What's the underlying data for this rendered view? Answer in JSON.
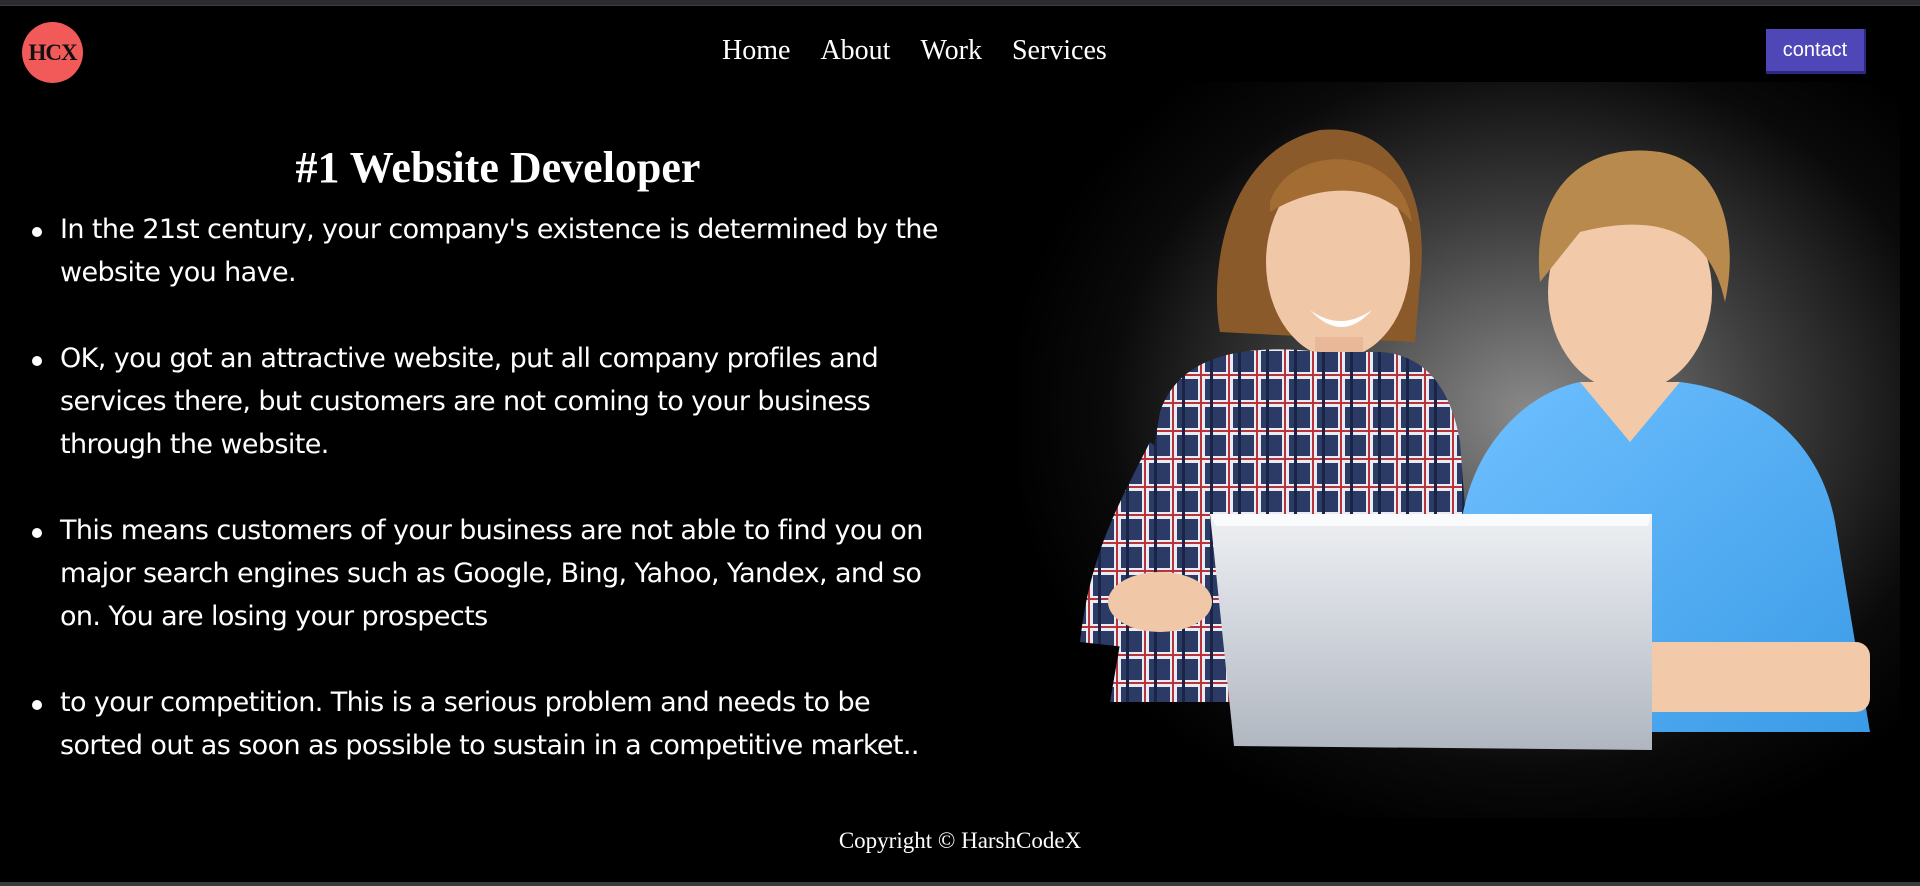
{
  "header": {
    "logo_text": "HCX",
    "nav": [
      "Home",
      "About",
      "Work",
      "Services"
    ],
    "contact_label": "contact"
  },
  "main": {
    "title": "#1 Website Developer",
    "points": [
      "In the 21st century, your company's existence is determined by the website you have.",
      "OK, you got an attractive website, put all company profiles and services there, but customers are not coming to your business through the website.",
      "This means customers of your business are not able to find you on major search engines such as Google, Bing, Yahoo, Yandex, and so on. You are losing your prospects",
      "to your competition. This is a serious problem and needs to be sorted out as soon as possible to sustain in a competitive market.."
    ]
  },
  "footer": {
    "copyright": "Copyright © HarshCodeX"
  },
  "colors": {
    "background": "#000000",
    "logo_bg": "#f25a5a",
    "contact_bg": "#4f47b8",
    "text": "#ffffff"
  }
}
